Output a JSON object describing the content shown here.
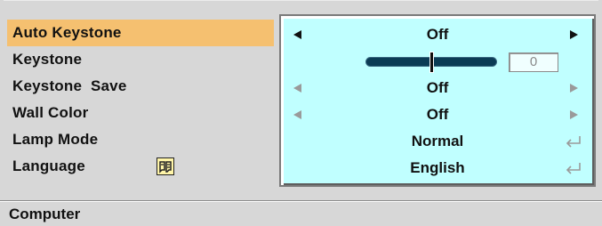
{
  "menu": {
    "items": [
      {
        "label": "Auto Keystone"
      },
      {
        "label": "Keystone"
      },
      {
        "label": "Keystone  Save"
      },
      {
        "label": "Wall Color"
      },
      {
        "label": "Lamp Mode"
      },
      {
        "label": "Language"
      }
    ]
  },
  "values": {
    "auto_keystone": "Off",
    "keystone_value": "0",
    "keystone_level": 0.5,
    "keystone_save": "Off",
    "wall_color": "Off",
    "lamp_mode": "Normal",
    "language": "English"
  },
  "icons": {
    "left_arrow": "left-arrow-icon",
    "right_arrow": "right-arrow-icon",
    "enter": "enter-icon",
    "language": "language-icon"
  },
  "colors": {
    "selected_row": "#f5c070",
    "value_panel": "#c0ffff",
    "background": "#d7d7d7",
    "slider": "#0b3c55"
  },
  "footer": {
    "source": "Computer"
  }
}
